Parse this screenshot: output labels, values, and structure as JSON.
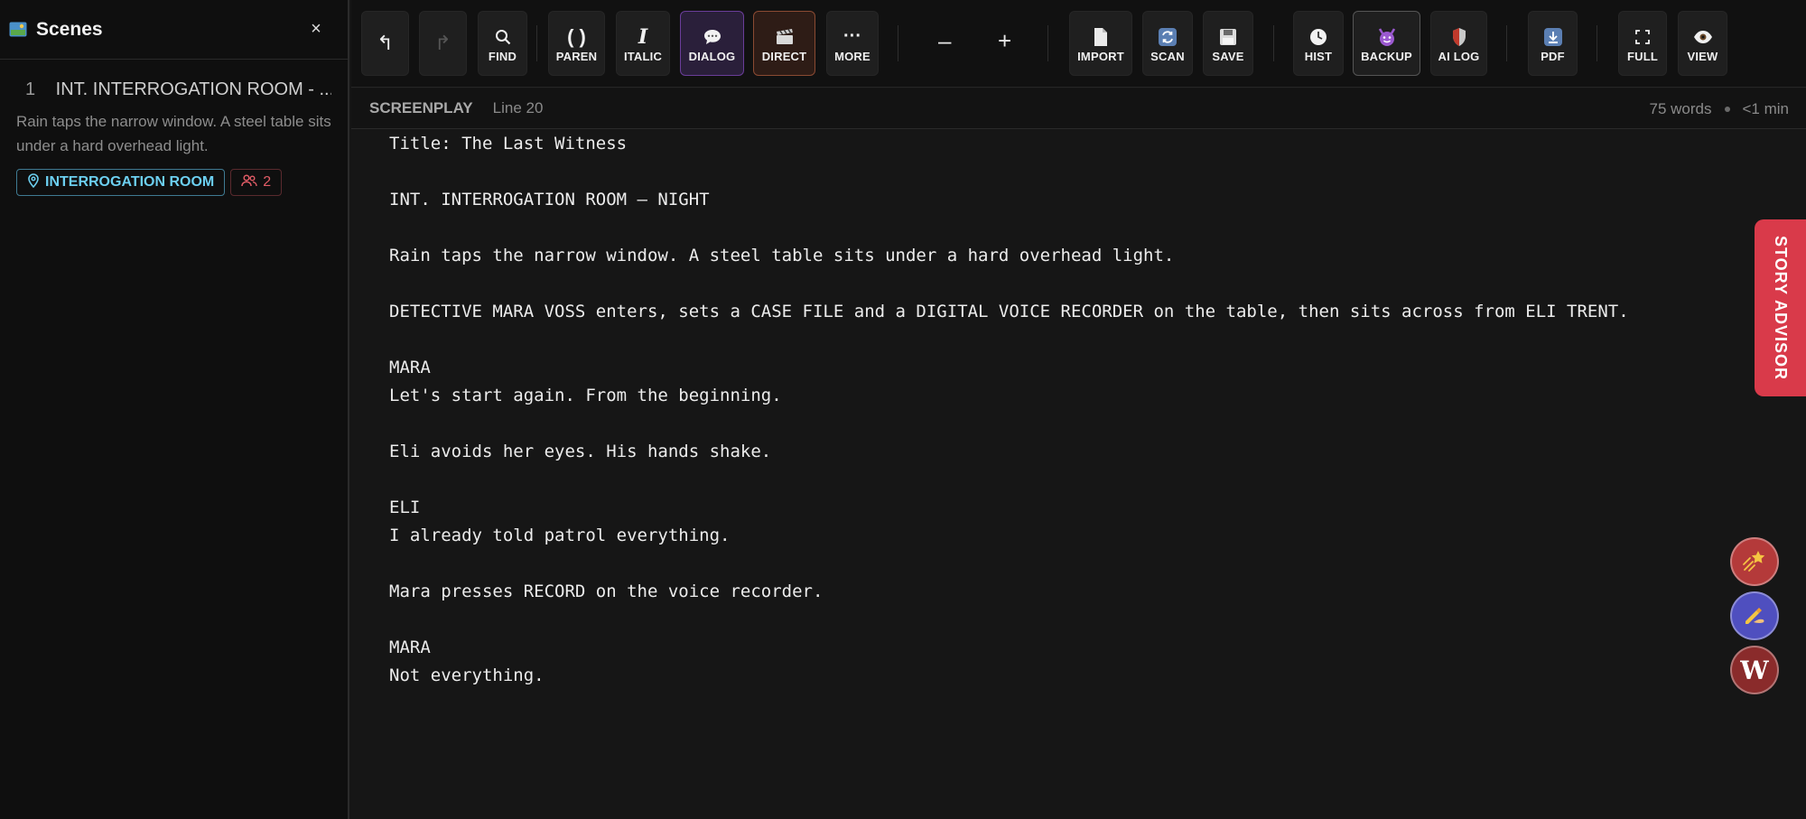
{
  "sidebar": {
    "title": "Scenes",
    "close": "×",
    "scenes": [
      {
        "number": "1",
        "heading": "INT. INTERROGATION ROOM - ...",
        "description": "Rain taps the narrow window. A steel table sits under a hard overhead light.",
        "location_tag": "INTERROGATION ROOM",
        "cast_count": "2"
      }
    ]
  },
  "toolbar": {
    "undo": "↰",
    "redo": "↱",
    "find": "FIND",
    "paren_glyph": "( )",
    "paren": "PAREN",
    "italic_glyph": "I",
    "italic": "ITALIC",
    "dialog": "DIALOG",
    "direct": "DIRECT",
    "more_glyph": "···",
    "more": "MORE",
    "zoom_out": "–",
    "zoom_in": "+",
    "import": "IMPORT",
    "scan": "SCAN",
    "save": "SAVE",
    "hist": "HIST",
    "backup": "BACKUP",
    "ailog": "AI LOG",
    "pdf": "PDF",
    "full": "FULL",
    "view": "VIEW"
  },
  "status": {
    "mode": "SCREENPLAY",
    "line": "Line 20",
    "words": "75 words",
    "time": "<1 min"
  },
  "script_lines": [
    "Title: The Last Witness",
    "",
    "INT. INTERROGATION ROOM – NIGHT",
    "",
    "Rain taps the narrow window. A steel table sits under a hard overhead light.",
    "",
    "DETECTIVE MARA VOSS enters, sets a CASE FILE and a DIGITAL VOICE RECORDER on the table, then sits across from ELI TRENT.",
    "",
    "MARA",
    "Let's start again. From the beginning.",
    "",
    "Eli avoids her eyes. His hands shake.",
    "",
    "ELI",
    "I already told patrol everything.",
    "",
    "Mara presses RECORD on the voice recorder.",
    "",
    "MARA",
    "Not everything."
  ],
  "advisor": {
    "label": "STORY ADVISOR"
  },
  "fabs": {
    "w_label": "W"
  },
  "colors": {
    "accent_red": "#d93a4a",
    "location_cyan": "#6ccff0",
    "dialog_purple": "#6a3d99",
    "direct_orange": "#8a4a32"
  }
}
